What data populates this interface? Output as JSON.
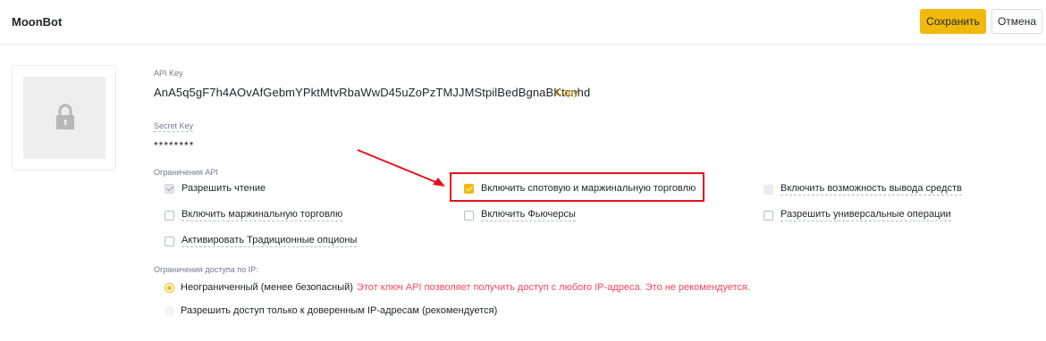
{
  "header": {
    "title": "MoonBot",
    "save_label": "Сохранить",
    "cancel_label": "Отмена"
  },
  "thumbnail": {
    "icon": "lock-icon"
  },
  "api_key": {
    "label": "API Key",
    "value": "AnA5q5gF7h4AOvAfGebmYPktMtvRbaWwD45uZoPzTMJJMStpilBedBgnaBKtcnhd",
    "copy_label": "Copy"
  },
  "secret_key": {
    "label": "Secret Key",
    "value": "********"
  },
  "restrictions": {
    "label": "Ограничения API",
    "items": [
      {
        "label": "Разрешить чтение",
        "state": "checked-disabled"
      },
      {
        "label": "Включить спотовую и маржинальную торговлю",
        "state": "checked"
      },
      {
        "label": "Включить возможность вывода средств",
        "state": "disabled"
      },
      {
        "label": "Включить маржинальную торговлю",
        "state": "unchecked"
      },
      {
        "label": "Включить Фьючерсы",
        "state": "unchecked"
      },
      {
        "label": "Разрешить универсальные операции",
        "state": "unchecked"
      },
      {
        "label": "Активировать Традиционные опционы",
        "state": "unchecked"
      }
    ]
  },
  "ip_access": {
    "label": "Ограничения доступа по IP:",
    "options": [
      {
        "label": "Неограниченный (менее безопасный)",
        "warning": "Этот ключ API позволяет получить доступ с любого IP-адреса. Это не рекомендуется.",
        "selected": true
      },
      {
        "label": "Разрешить доступ только к доверенным IP-адресам (рекомендуется)",
        "selected": false
      }
    ]
  },
  "colors": {
    "accent": "#f0b90b",
    "warning": "#f6465d",
    "annotation_red": "#e8101a"
  }
}
